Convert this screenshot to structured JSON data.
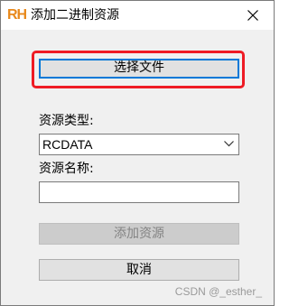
{
  "window": {
    "logo_text": "RH",
    "title": "添加二进制资源"
  },
  "dialog": {
    "choose_file_label": "选择文件",
    "resource_type_label": "资源类型:",
    "resource_type_value": "RCDATA",
    "resource_name_label": "资源名称:",
    "resource_name_value": "",
    "add_resource_label": "添加资源",
    "cancel_label": "取消"
  },
  "watermark": "CSDN @_esther_",
  "colors": {
    "highlight": "#ee1b24",
    "logo": "#e8891c",
    "focus": "#0078d7"
  },
  "icons": {
    "close": "close-icon",
    "dropdown": "chevron-down-icon"
  }
}
